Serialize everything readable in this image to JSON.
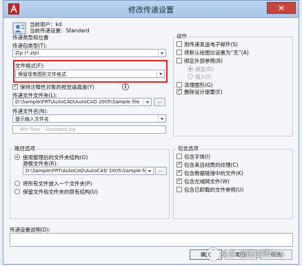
{
  "window": {
    "title": "修改传递设置",
    "close_label": "✕"
  },
  "header": {
    "current_user": "当前用户：kd",
    "current_setup": "当前传递设置：Standard"
  },
  "package_section": {
    "title": "传递类型和位置",
    "type_label": "传递包类型(T):",
    "type_value": "Zip (*.zip)",
    "format_label": "文件格式(F):",
    "format_value": "保留现有图形文件格式",
    "maintain_visual_label": "保持注释性对象的视觉逼真度(Y)",
    "maintain_visual_checked": true,
    "info_icon_label": "i",
    "folder_label": "传递文件文件夹(L):",
    "folder_value": "D:\\Sample\\FRT\\AutoCAD\\AutoCAD 2005\\Sample file",
    "browse_label": "...",
    "name_label": "传递文件名(N):",
    "name_value": "提示输入文件名",
    "name_preview": "8th floor - Standard.zip"
  },
  "path_section": {
    "title": "路径选项",
    "opt1_label": "使用整理后的文件夹结构(O)",
    "source_root_label": "源根文件夹(R):",
    "source_root_value": "D:\\Sample\\FRT\\AutoCAD\\AutoCAD 2005\\Sample fol",
    "browse_label": "...",
    "opt2_label": "将所有文件放入一个文件夹(P)",
    "opt3_label": "保留文件和文件夹的原有结构(U)"
  },
  "actions_section": {
    "title": "动作",
    "items": [
      {
        "label": "用传递发送电子邮件(S)",
        "checked": false
      },
      {
        "label": "将默认绘图仪设置为“无”(A)",
        "checked": false
      },
      {
        "label": "绑定外部参照(B)",
        "checked": false
      }
    ],
    "bind_option": "绑定(D)",
    "insert_option": "插入(I)",
    "purge_label": "清理图形(G)",
    "purge_checked": false,
    "remove_label": "删除设计提要(E)",
    "remove_checked": true
  },
  "include_section": {
    "title": "包含选项",
    "items": [
      {
        "label": "包含字体(I)",
        "checked": false
      },
      {
        "label": "包含来自材质的纹理(C)",
        "checked": true
      },
      {
        "label": "包含数据链接中的文件(K)",
        "checked": true
      },
      {
        "label": "包含光域网文件(W)",
        "checked": true
      },
      {
        "label": "包含已卸载的文件参照(U)",
        "checked": false
      }
    ]
  },
  "description": {
    "label": "传递设置说明(D):",
    "value": ""
  },
  "buttons": {
    "ok": "确定",
    "cancel": "取消",
    "help": "帮助"
  },
  "watermark": "头条 @建造师bics"
}
